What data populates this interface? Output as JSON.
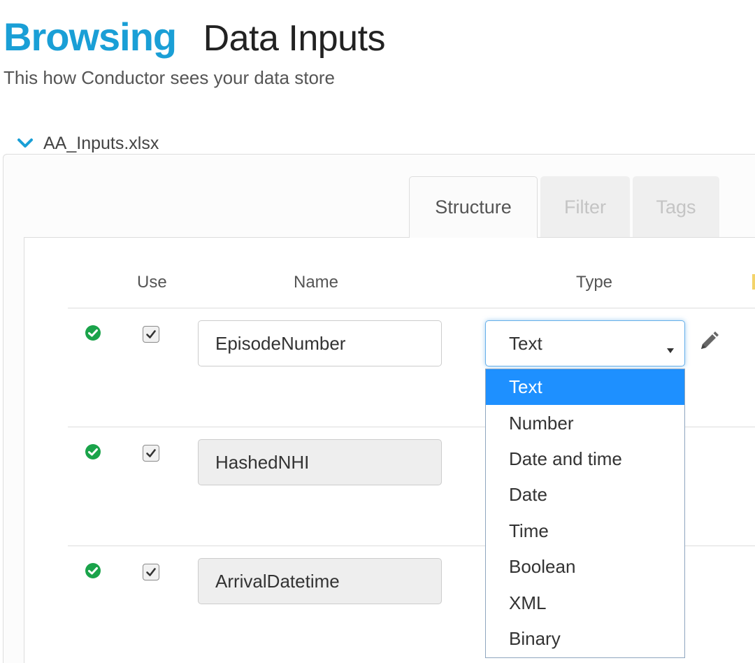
{
  "header": {
    "title_accent": "Browsing",
    "title_main": "Data Inputs",
    "subtitle": "This how Conductor sees your data store"
  },
  "file": {
    "name": "AA_Inputs.xlsx",
    "expanded": true
  },
  "tabs": [
    {
      "label": "Structure",
      "active": true
    },
    {
      "label": "Filter",
      "active": false
    },
    {
      "label": "Tags",
      "active": false
    }
  ],
  "columns": {
    "use": "Use",
    "name": "Name",
    "type": "Type"
  },
  "rows": [
    {
      "name": "EpisodeNumber",
      "use_checked": true,
      "status": "valid",
      "editable": true
    },
    {
      "name": "HashedNHI",
      "use_checked": true,
      "status": "valid",
      "editable": false
    },
    {
      "name": "ArrivalDatetime",
      "use_checked": true,
      "status": "valid",
      "editable": false
    }
  ],
  "type_select": {
    "selected": "Text",
    "options": [
      "Text",
      "Number",
      "Date and time",
      "Date",
      "Time",
      "Boolean",
      "XML",
      "Binary"
    ]
  },
  "colors": {
    "accent": "#1a9fd6",
    "valid_icon": "#1aa34a",
    "selected_option": "#1e90ff",
    "focus_border": "#66afe9"
  },
  "icons": {
    "status": "check-circle-icon",
    "expand": "chevron-down-icon",
    "edit": "pencil-icon",
    "select": "caret-down-icon"
  }
}
